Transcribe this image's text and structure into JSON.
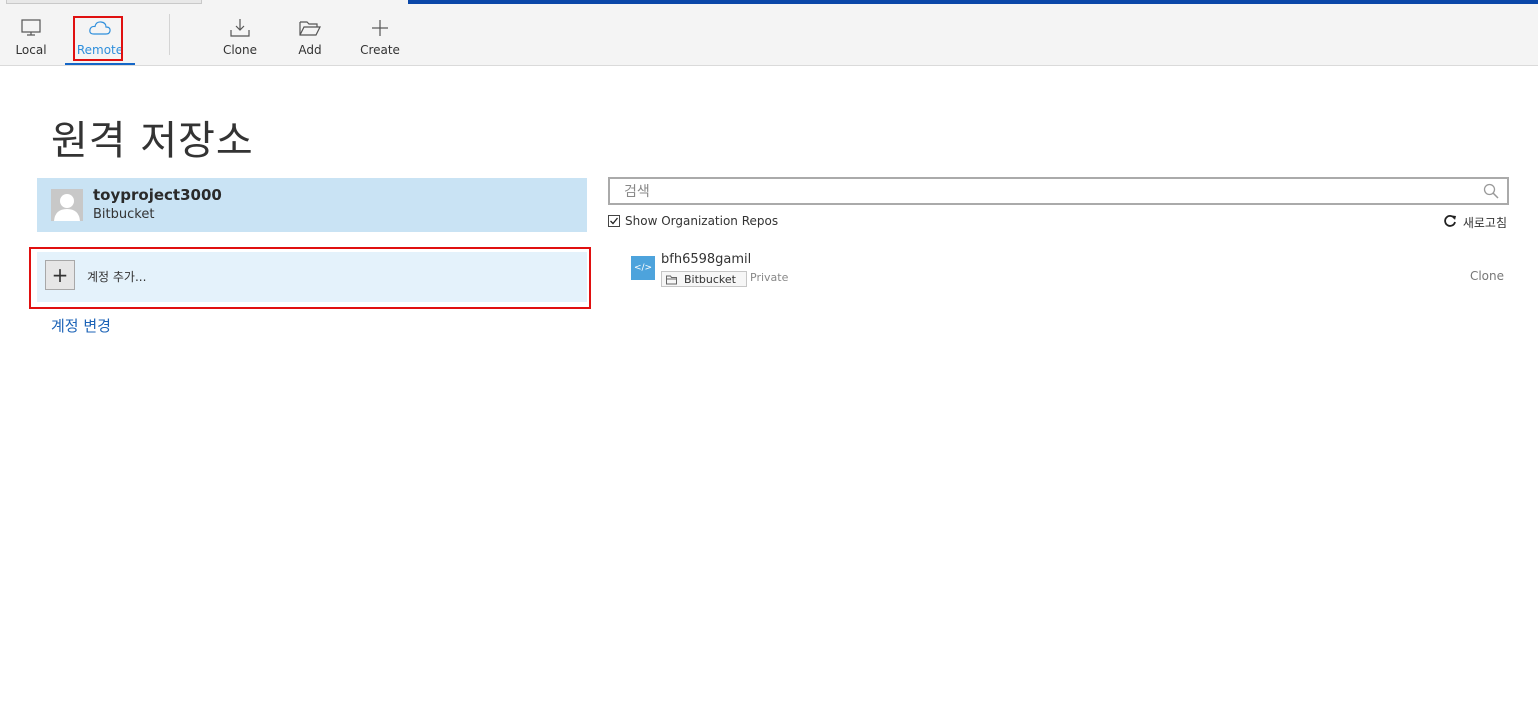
{
  "toolbar": {
    "local_label": "Local",
    "remote_label": "Remote",
    "clone_label": "Clone",
    "add_label": "Add",
    "create_label": "Create"
  },
  "page": {
    "title": "원격 저장소"
  },
  "accounts": {
    "items": [
      {
        "name": "toyproject3000",
        "host": "Bitbucket"
      }
    ],
    "add_label": "계정 추가...",
    "change_label": "계정 변경"
  },
  "repos": {
    "search_placeholder": "검색",
    "show_org_label": "Show Organization Repos",
    "show_org_checked": true,
    "refresh_label": "새로고침",
    "items": [
      {
        "name": "bfh6598gamil",
        "host": "Bitbucket",
        "visibility": "Private",
        "clone_label": "Clone"
      }
    ]
  },
  "colors": {
    "accent": "#1466c7",
    "highlight_box": "#e01010",
    "selected_account_bg": "#c9e3f4",
    "repo_icon": "#4da3dc"
  },
  "icons": {
    "local": "monitor-icon",
    "remote": "cloud-icon",
    "clone": "download-icon",
    "add": "folder-open-icon",
    "create": "plus-icon"
  }
}
